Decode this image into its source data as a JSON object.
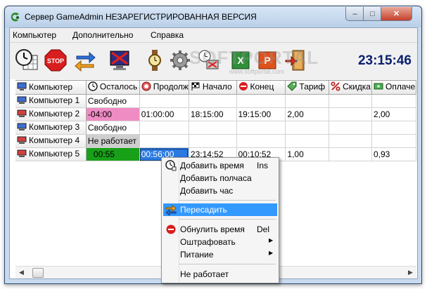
{
  "window": {
    "title": "Сервер GameAdmin НЕЗАРЕГИСТРИРОВАННАЯ ВЕРСИЯ",
    "minimize_glyph": "–",
    "maximize_glyph": "□",
    "close_glyph": "✕"
  },
  "menubar": {
    "items": [
      "Компьютер",
      "Дополнительно",
      "Справка"
    ]
  },
  "toolbar": {
    "buttons": [
      "calendar-clock-icon",
      "stop-icon",
      "swap-arrows-icon",
      "monitor-off-icon",
      "wristwatch-icon",
      "gear-icon",
      "monitor-clock-icon",
      "excel-icon",
      "powerpoint-icon",
      "exit-door-icon"
    ],
    "clock": "23:15:46",
    "watermark": "SOFTPORTAL",
    "watermark_url": "www.softportal.com"
  },
  "grid": {
    "columns": [
      {
        "label": "Компьютер",
        "icon": "computer-icon"
      },
      {
        "label": "Осталось",
        "icon": "clock-icon"
      },
      {
        "label": "Продолж",
        "icon": "alarm-icon"
      },
      {
        "label": "Начало",
        "icon": "flag-icon"
      },
      {
        "label": "Конец",
        "icon": "stop-sign-icon"
      },
      {
        "label": "Тариф",
        "icon": "tag-icon"
      },
      {
        "label": "Скидка",
        "icon": "percent-icon"
      },
      {
        "label": "Оплаче",
        "icon": "money-icon"
      }
    ],
    "rows": [
      {
        "name": "Компьютер 1",
        "remaining": "Свободно",
        "duration": "",
        "start": "",
        "end": "",
        "tariff": "",
        "discount": "",
        "paid": "",
        "state": "free"
      },
      {
        "name": "Компьютер 2",
        "remaining": "-04:00",
        "duration": "01:00:00",
        "start": "18:15:00",
        "end": "19:15:00",
        "tariff": "2,00",
        "discount": "",
        "paid": "2,00",
        "state": "overdue"
      },
      {
        "name": "Компьютер 3",
        "remaining": "Свободно",
        "duration": "",
        "start": "",
        "end": "",
        "tariff": "",
        "discount": "",
        "paid": "",
        "state": "free"
      },
      {
        "name": "Компьютер 4",
        "remaining": "Не работает",
        "duration": "",
        "start": "",
        "end": "",
        "tariff": "",
        "discount": "",
        "paid": "",
        "state": "off"
      },
      {
        "name": "Компьютер 5",
        "remaining": "00:55",
        "duration": "00:56:00",
        "start": "23:14:52",
        "end": "00:10:52",
        "tariff": "1,00",
        "discount": "",
        "paid": "0,93",
        "state": "active"
      }
    ]
  },
  "context_menu": {
    "items": [
      {
        "label": "Добавить время",
        "shortcut": "Ins",
        "icon": "clock-add-icon"
      },
      {
        "label": "Добавить полчаса",
        "shortcut": ""
      },
      {
        "label": "Добавить час",
        "shortcut": ""
      },
      {
        "label": "Пересадить",
        "shortcut": "",
        "icon": "swap-arrows-icon",
        "highlighted": true
      },
      {
        "label": "Обнулить время",
        "shortcut": "Del",
        "icon": "reset-icon"
      },
      {
        "label": "Оштрафовать",
        "shortcut": "",
        "submenu": true
      },
      {
        "label": "Питание",
        "shortcut": "",
        "submenu": true
      },
      {
        "label": "Не работает",
        "shortcut": ""
      }
    ],
    "submenu_glyph": "▶"
  },
  "colors": {
    "overdue": "#f08cc4",
    "off": "#cfcfcf",
    "active": "#19a019",
    "selected": "#2a7ae2",
    "clock": "#0a1f6e"
  }
}
